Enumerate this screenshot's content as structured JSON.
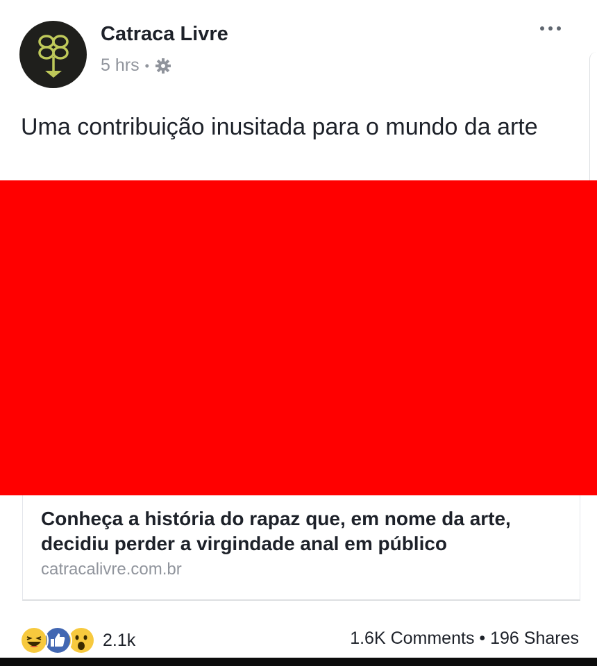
{
  "post": {
    "page_name": "Catraca Livre",
    "time": "5 hrs",
    "privacy_icon": "globe-gear-icon",
    "text": "Uma contribuição inusitada para o mundo da arte",
    "media_color": "#ff0000"
  },
  "link": {
    "title": "Conheça a história do rapaz que, em nome da arte, decidiu perder a virgindade anal em público",
    "domain": "catracalivre.com.br"
  },
  "footer": {
    "reactions": [
      "haha-icon",
      "like-icon",
      "wow-icon"
    ],
    "reaction_count": "2.1k",
    "comments": "1.6K Comments",
    "shares": "196 Shares",
    "separator": "•"
  },
  "colors": {
    "text": "#1d2129",
    "muted": "#90949c",
    "like_blue": "#4267b2",
    "haha_yellow": "#f7c93e",
    "logo_green": "#bfc95a"
  }
}
